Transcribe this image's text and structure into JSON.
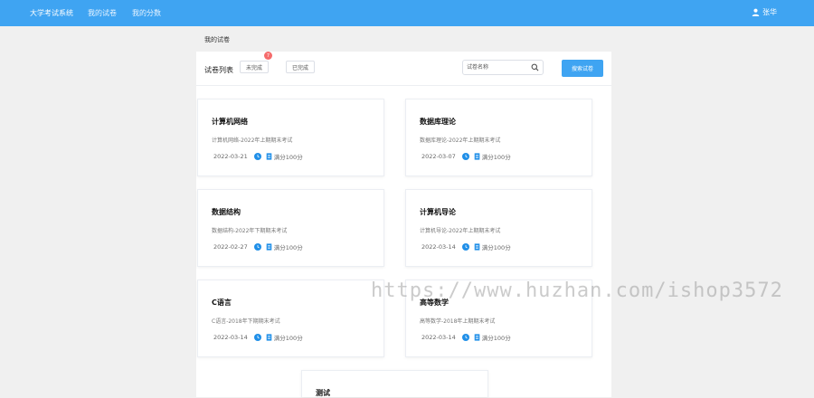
{
  "header": {
    "brand": "大学考试系统",
    "nav": [
      "我的试卷",
      "我的分数"
    ],
    "user": "张华"
  },
  "page_title": "我的试卷",
  "toolbar": {
    "list_label": "试卷列表",
    "tabs": [
      "未完成",
      "已完成"
    ],
    "badge": "7",
    "search_placeholder": "试卷名称",
    "search_button": "搜索试卷"
  },
  "exams": [
    {
      "title": "计算机网络",
      "desc": "计算机网络-2022年上期期末考试",
      "date": "2022-03-21",
      "score": "满分100分"
    },
    {
      "title": "数据库理论",
      "desc": "数据库理论-2022年上期期末考试",
      "date": "2022-03-07",
      "score": "满分100分"
    },
    {
      "title": "数据结构",
      "desc": "数据结构-2022年下期期末考试",
      "date": "2022-02-27",
      "score": "满分100分"
    },
    {
      "title": "计算机导论",
      "desc": "计算机导论-2022年上期期末考试",
      "date": "2022-03-14",
      "score": "满分100分"
    },
    {
      "title": "C语言",
      "desc": "C语言-2018年下期期末考试",
      "date": "2022-03-14",
      "score": "满分100分"
    },
    {
      "title": "高等数学",
      "desc": "高等数学-2018年上期期末考试",
      "date": "2022-03-14",
      "score": "满分100分"
    },
    {
      "title": "测试"
    }
  ],
  "watermark": "https://www.huzhan.com/ishop3572",
  "colors": {
    "primary": "#3fa4f2",
    "badge": "#f56c6c",
    "background": "#f0f0f0"
  }
}
